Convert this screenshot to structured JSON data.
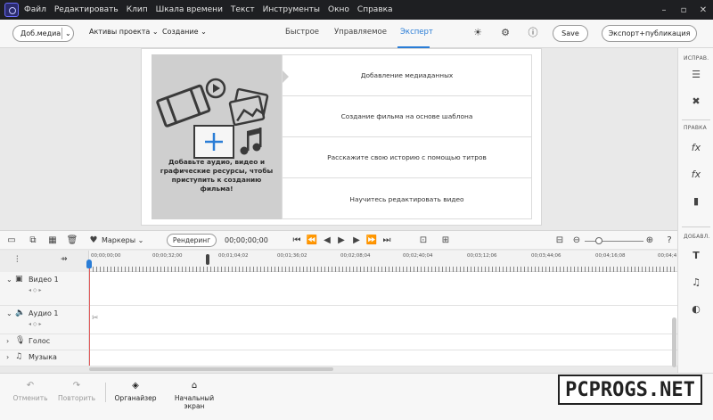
{
  "menubar": {
    "items": [
      "Файл",
      "Редактировать",
      "Клип",
      "Шкала времени",
      "Текст",
      "Инструменты",
      "Окно",
      "Справка"
    ]
  },
  "toolbar": {
    "add_media": "Доб.медиа",
    "project_assets": "Активы проекта",
    "create": "Создание",
    "modes": [
      "Быстрое",
      "Управляемое",
      "Эксперт"
    ],
    "active_mode": "Эксперт",
    "save": "Save",
    "export": "Экспорт+публикация"
  },
  "start": {
    "welcome_text": "Добавьте аудио, видео и графические ресурсы, чтобы приступить к созданию фильма!",
    "options": [
      "Добавление медиаданных",
      "Создание фильма на основе шаблона",
      "Расскажите свою историю с помощью титров",
      "Научитесь редактировать видео"
    ]
  },
  "rightpanel": {
    "labels": [
      "ИСПРАВ.",
      "ПРАВКА",
      "ДОБАВЛ."
    ]
  },
  "timeline": {
    "markers": "Маркеры",
    "render": "Рендеринг",
    "timecode": "00;00;00;00",
    "ruler_labels": [
      "00;00;00;00",
      "00;00;32;00",
      "00;01;04;02",
      "00;01;36;02",
      "00;02;08;04",
      "00;02;40;04",
      "00;03;12;06",
      "00;03;44;06",
      "00;04;16;08",
      "00;04;4"
    ],
    "tracks": [
      {
        "name": "Видео 1",
        "sub": "◂ ◇ ▸"
      },
      {
        "name": "Аудио 1",
        "sub": "◂ ◇ ▸"
      },
      {
        "name": "Голос",
        "sub": ""
      },
      {
        "name": "Музыка",
        "sub": ""
      }
    ]
  },
  "bottombar": {
    "undo": "Отменить",
    "redo": "Повторить",
    "organizer": "Органайзер",
    "home": "Начальный экран"
  },
  "watermark": "PCPROGS.NET"
}
